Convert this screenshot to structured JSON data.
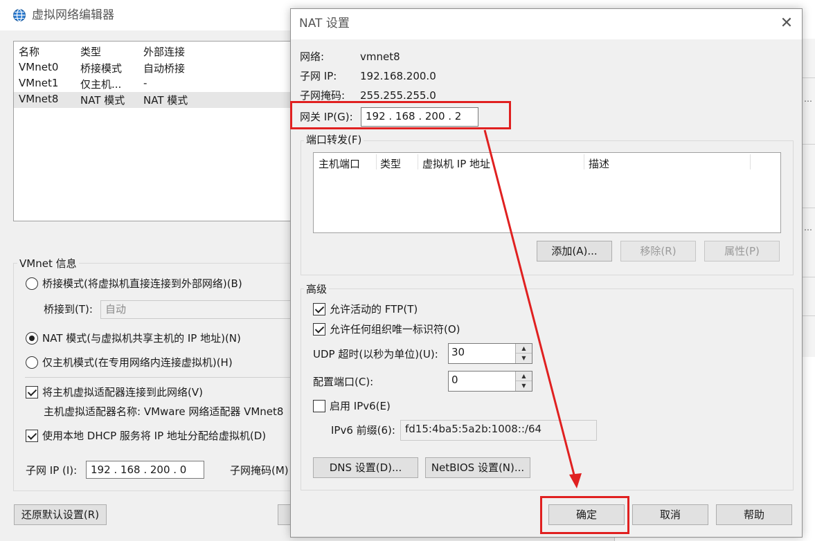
{
  "colors": {
    "annotation": "#e02020",
    "dialog_bg": "#f0f0f0"
  },
  "editor": {
    "title": "虚拟网络编辑器",
    "icon": "globe-icon",
    "list": {
      "columns": [
        "名称",
        "类型",
        "外部连接"
      ],
      "rows": [
        [
          "VMnet0",
          "桥接模式",
          "自动桥接"
        ],
        [
          "VMnet1",
          "仅主机...",
          "-"
        ],
        [
          "VMnet8",
          "NAT 模式",
          "NAT 模式"
        ]
      ]
    },
    "info": {
      "title": "VMnet 信息",
      "bridged_label": "桥接模式(将虚拟机直接连接到外部网络)(B)",
      "bridge_to_label": "桥接到(T):",
      "bridge_to_value": "自动",
      "nat_label": "NAT 模式(与虚拟机共享主机的 IP 地址)(N)",
      "hostonly_label": "仅主机模式(在专用网络内连接虚拟机)(H)",
      "connect_adapter_label": "将主机虚拟适配器连接到此网络(V)",
      "adapter_name_text": "主机虚拟适配器名称: VMware 网络适配器 VMnet8",
      "dhcp_label": "使用本地 DHCP 服务将 IP 地址分配给虚拟机(D)",
      "subnet_ip_label": "子网 IP (I):",
      "subnet_ip_value": "192 . 168 . 200 .  0",
      "subnet_mask_label": "子网掩码(M)"
    },
    "restore_button": "还原默认设置(R)"
  },
  "nat": {
    "title": "NAT 设置",
    "close_icon": "close-icon",
    "network_label": "网络:",
    "network_value": "vmnet8",
    "subnet_ip_label": "子网 IP:",
    "subnet_ip_value": "192.168.200.0",
    "subnet_mask_label": "子网掩码:",
    "subnet_mask_value": "255.255.255.0",
    "gateway_label": "网关 IP(G):",
    "gateway_value": "192 . 168 . 200 .  2",
    "port_forwarding": {
      "title": "端口转发(F)",
      "columns": [
        "主机端口",
        "类型",
        "虚拟机 IP 地址",
        "描述"
      ],
      "add_button": "添加(A)...",
      "remove_button": "移除(R)",
      "properties_button": "属性(P)"
    },
    "advanced": {
      "title": "高级",
      "ftp_label": "允许活动的 FTP(T)",
      "oui_label": "允许任何组织唯一标识符(O)",
      "udp_timeout_label": "UDP 超时(以秒为单位)(U):",
      "udp_timeout_value": "30",
      "config_port_label": "配置端口(C):",
      "config_port_value": "0",
      "ipv6_label": "启用 IPv6(E)",
      "ipv6_prefix_label": "IPv6 前缀(6):",
      "ipv6_prefix_value": "fd15:4ba5:5a2b:1008::/64",
      "dns_button": "DNS 设置(D)...",
      "netbios_button": "NetBIOS 设置(N)..."
    },
    "ok_button": "确定",
    "cancel_button": "取消",
    "help_button": "帮助"
  }
}
